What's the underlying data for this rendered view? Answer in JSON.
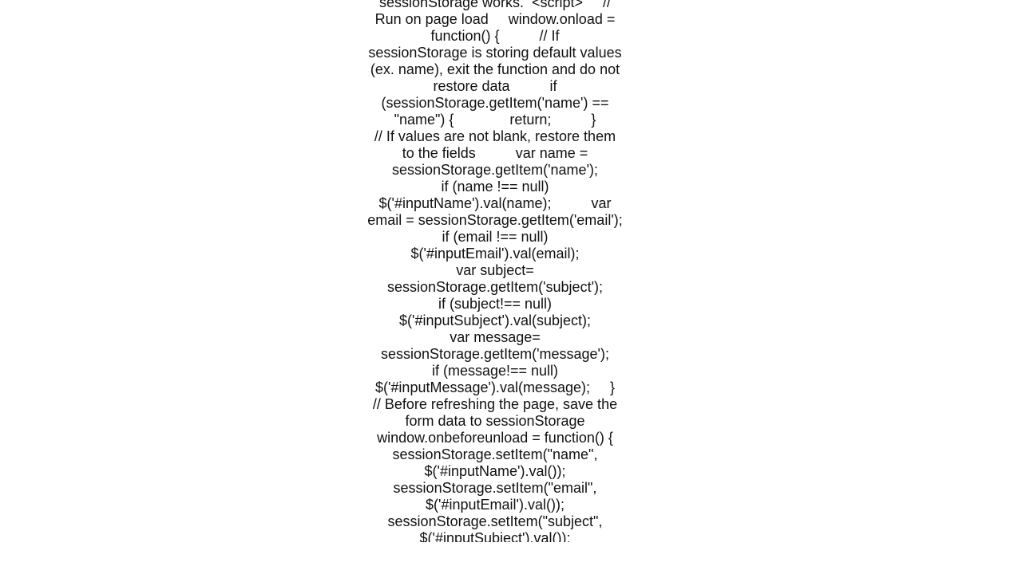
{
  "document": {
    "lines": [
      "sessionStorage works.  <script>     //",
      "Run on page load     window.onload =",
      "function() {          // If",
      "sessionStorage is storing default values",
      "(ex. name), exit the function and do not",
      "restore data          if",
      "(sessionStorage.getItem('name') ==",
      "\"name\") {              return;          }",
      "// If values are not blank, restore them",
      "to the fields          var name =",
      "sessionStorage.getItem('name');",
      "if (name !== null)",
      "$('#inputName').val(name);          var",
      "email = sessionStorage.getItem('email');",
      "if (email !== null)",
      "$('#inputEmail').val(email);",
      "var subject=",
      "sessionStorage.getItem('subject');",
      "if (subject!== null)",
      "$('#inputSubject').val(subject);",
      "var message=",
      "sessionStorage.getItem('message');",
      "if (message!== null)",
      "$('#inputMessage').val(message);     }",
      "// Before refreshing the page, save the",
      "form data to sessionStorage",
      "window.onbeforeunload = function() {",
      "sessionStorage.setItem(\"name\",",
      "$('#inputName').val());",
      "sessionStorage.setItem(\"email\",",
      "$('#inputEmail').val());",
      "sessionStorage.setItem(\"subject\",",
      "$('#inputSubject').val());"
    ]
  }
}
